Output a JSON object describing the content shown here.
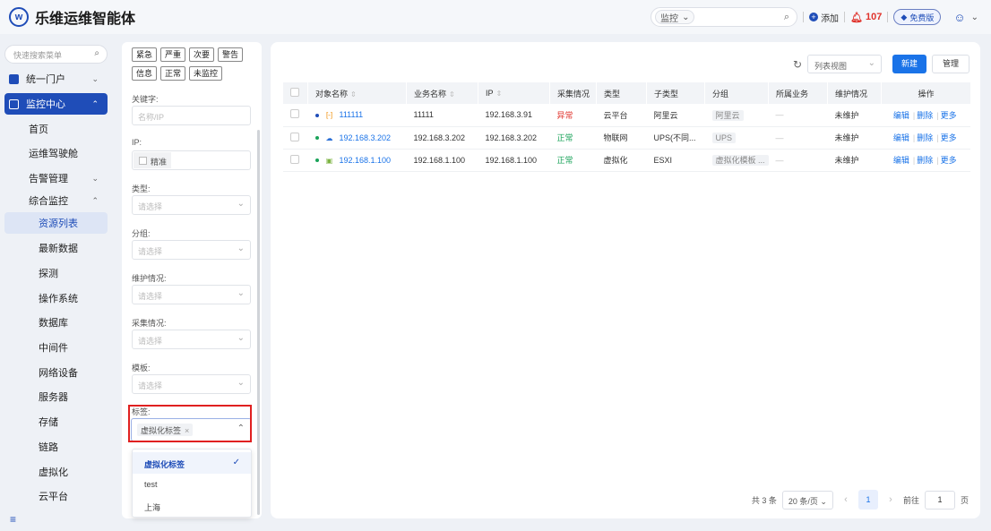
{
  "app": {
    "logo_letter": "w",
    "title": "乐维运维智能体"
  },
  "topbar": {
    "search_scope": "监控",
    "add_label": "添加",
    "alert_count": "107",
    "free_label": "免费版"
  },
  "sidebar": {
    "search_placeholder": "快速搜索菜单",
    "portal": "统一门户",
    "monitor_center": "监控中心",
    "home": "首页",
    "cockpit": "运维驾驶舱",
    "alarm_mgmt": "告警管理",
    "integrated": "综合监控",
    "items": [
      "资源列表",
      "最新数据",
      "探测",
      "操作系统",
      "数据库",
      "中间件",
      "网络设备",
      "服务器",
      "存储",
      "链路",
      "虚拟化",
      "云平台"
    ]
  },
  "filter": {
    "severity": [
      "紧急",
      "严重",
      "次要",
      "警告",
      "信息",
      "正常",
      "未监控"
    ],
    "keyword_label": "关键字:",
    "keyword_placeholder": "名称/IP",
    "ip_label": "IP:",
    "exact_label": "精准",
    "type_label": "类型:",
    "group_label": "分组:",
    "maint_label": "维护情况:",
    "collect_label": "采集情况:",
    "template_label": "模板:",
    "select_placeholder": "请选择",
    "tag_label": "标签:",
    "tag_selected": "虚拟化标签",
    "tag_options": [
      "虚拟化标签",
      "test",
      "上海"
    ]
  },
  "main": {
    "view_select": "列表视图",
    "new_button": "新建",
    "manage_button": "管理",
    "columns": [
      "对象名称",
      "业务名称",
      "IP",
      "采集情况",
      "类型",
      "子类型",
      "分组",
      "所属业务",
      "维护情况",
      "操作"
    ],
    "rows": [
      {
        "name": "111111",
        "business": "11111",
        "ip": "192.168.3.91",
        "collect": "异常",
        "type": "云平台",
        "subtype": "阿里云",
        "group": "阿里云",
        "owner": "—",
        "maint": "未维护"
      },
      {
        "name": "192.168.3.202",
        "business": "192.168.3.202",
        "ip": "192.168.3.202",
        "collect": "正常",
        "type": "物联网",
        "subtype": "UPS(不同...",
        "group": "UPS",
        "owner": "—",
        "maint": "未维护"
      },
      {
        "name": "192.168.1.100",
        "business": "192.168.1.100",
        "ip": "192.168.1.100",
        "collect": "正常",
        "type": "虚拟化",
        "subtype": "ESXI",
        "group": "虚拟化模板 ...",
        "owner": "—",
        "maint": "未维护"
      }
    ],
    "ops": {
      "edit": "编辑",
      "delete": "删除",
      "more": "更多"
    },
    "pager": {
      "total": "共 3 条",
      "page_size": "20 条/页",
      "current": "1",
      "goto_prefix": "前往",
      "goto_value": "1",
      "goto_suffix": "页"
    }
  },
  "colors": {
    "primary": "#1f4db8",
    "link": "#1a73e8",
    "danger": "#e0332c",
    "ok": "#1aa35a"
  }
}
